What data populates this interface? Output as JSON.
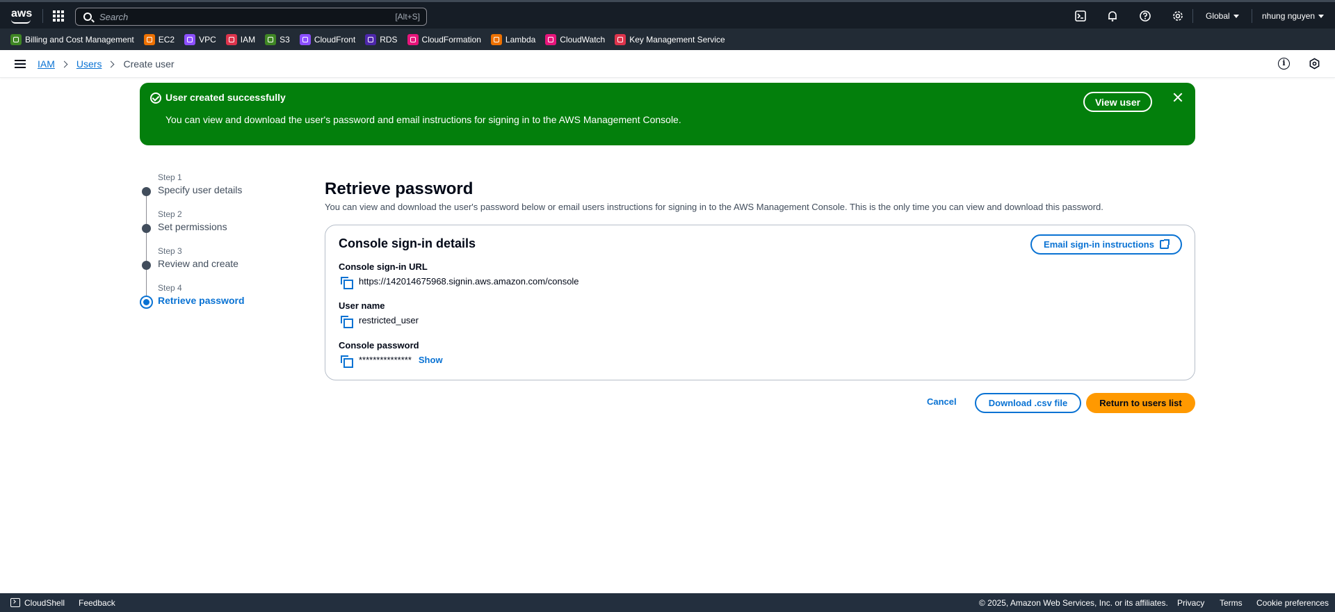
{
  "topnav": {
    "logo_text": "aws",
    "search_placeholder": "Search",
    "search_shortcut": "[Alt+S]",
    "region": "Global",
    "user": "nhung nguyen"
  },
  "favorites": [
    {
      "label": "Billing and Cost Management",
      "color": "#3f8624"
    },
    {
      "label": "EC2",
      "color": "#ed7100"
    },
    {
      "label": "VPC",
      "color": "#8c4fff"
    },
    {
      "label": "IAM",
      "color": "#dd344c"
    },
    {
      "label": "S3",
      "color": "#3f8624"
    },
    {
      "label": "CloudFront",
      "color": "#8c4fff"
    },
    {
      "label": "RDS",
      "color": "#4d27aa"
    },
    {
      "label": "CloudFormation",
      "color": "#e7157b"
    },
    {
      "label": "Lambda",
      "color": "#ed7100"
    },
    {
      "label": "CloudWatch",
      "color": "#e7157b"
    },
    {
      "label": "Key Management Service",
      "color": "#dd344c"
    }
  ],
  "breadcrumb": {
    "items": [
      "IAM",
      "Users"
    ],
    "current": "Create user"
  },
  "flash": {
    "title": "User created successfully",
    "message": "You can view and download the user's password and email instructions for signing in to the AWS Management Console.",
    "button": "View user"
  },
  "steps": [
    {
      "num": "Step 1",
      "label": "Specify user details"
    },
    {
      "num": "Step 2",
      "label": "Set permissions"
    },
    {
      "num": "Step 3",
      "label": "Review and create"
    },
    {
      "num": "Step 4",
      "label": "Retrieve password"
    }
  ],
  "main": {
    "title": "Retrieve password",
    "subtitle": "You can view and download the user's password below or email users instructions for signing in to the AWS Management Console. This is the only time you can view and download this password.",
    "card_title": "Console sign-in details",
    "email_button": "Email sign-in instructions",
    "url_label": "Console sign-in URL",
    "url_value": "https://142014675968.signin.aws.amazon.com/console",
    "username_label": "User name",
    "username_value": "restricted_user",
    "password_label": "Console password",
    "password_value": "***************",
    "show_link": "Show"
  },
  "actions": {
    "cancel": "Cancel",
    "download": "Download .csv file",
    "return": "Return to users list"
  },
  "footer": {
    "cloudshell": "CloudShell",
    "feedback": "Feedback",
    "copyright": "© 2025, Amazon Web Services, Inc. or its affiliates.",
    "privacy": "Privacy",
    "terms": "Terms",
    "cookies": "Cookie preferences"
  }
}
